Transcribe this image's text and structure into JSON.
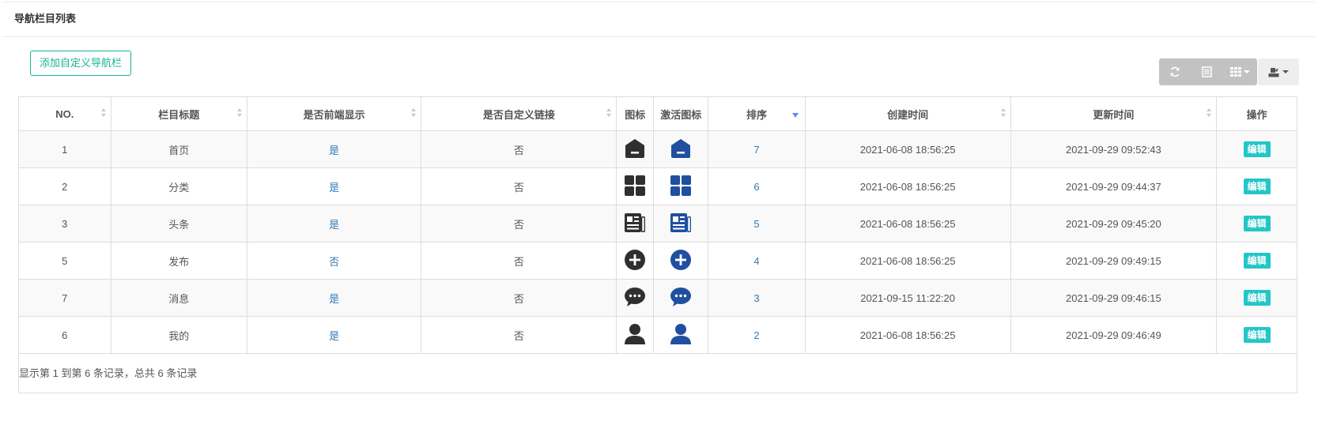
{
  "panel": {
    "title": "导航栏目列表"
  },
  "toolbar": {
    "add_label": "添加自定义导航栏",
    "buttons": [
      "refresh-icon",
      "list-view-icon",
      "columns-icon",
      "export-icon"
    ]
  },
  "colors": {
    "accent": "#1ab394",
    "edit": "#23c6c8",
    "link": "#337ab7",
    "icon_dark": "#2f2f2f",
    "icon_active": "#1f4fa0"
  },
  "table": {
    "headers": {
      "no": "NO.",
      "title": "栏目标题",
      "show_front": "是否前端显示",
      "custom_link": "是否自定义链接",
      "icon": "图标",
      "active_icon": "激活图标",
      "sort": "排序",
      "created": "创建时间",
      "updated": "更新时间",
      "actions": "操作"
    },
    "rows": [
      {
        "no": "1",
        "title": "首页",
        "show_front": "是",
        "custom_link": "否",
        "icon": "home-icon",
        "sort": "7",
        "created": "2021-06-08 18:56:25",
        "updated": "2021-09-29 09:52:43",
        "action": "编辑"
      },
      {
        "no": "2",
        "title": "分类",
        "show_front": "是",
        "custom_link": "否",
        "icon": "category-icon",
        "sort": "6",
        "created": "2021-06-08 18:56:25",
        "updated": "2021-09-29 09:44:37",
        "action": "编辑"
      },
      {
        "no": "3",
        "title": "头条",
        "show_front": "是",
        "custom_link": "否",
        "icon": "news-icon",
        "sort": "5",
        "created": "2021-06-08 18:56:25",
        "updated": "2021-09-29 09:45:20",
        "action": "编辑"
      },
      {
        "no": "5",
        "title": "发布",
        "show_front": "否",
        "custom_link": "否",
        "icon": "plus-circle-icon",
        "sort": "4",
        "created": "2021-06-08 18:56:25",
        "updated": "2021-09-29 09:49:15",
        "action": "编辑"
      },
      {
        "no": "7",
        "title": "消息",
        "show_front": "是",
        "custom_link": "否",
        "icon": "message-icon",
        "sort": "3",
        "created": "2021-09-15 11:22:20",
        "updated": "2021-09-29 09:46:15",
        "action": "编辑"
      },
      {
        "no": "6",
        "title": "我的",
        "show_front": "是",
        "custom_link": "否",
        "icon": "user-icon",
        "sort": "2",
        "created": "2021-06-08 18:56:25",
        "updated": "2021-09-29 09:46:49",
        "action": "编辑"
      }
    ]
  },
  "pagination": {
    "info": "显示第 1 到第 6 条记录，总共 6 条记录"
  }
}
